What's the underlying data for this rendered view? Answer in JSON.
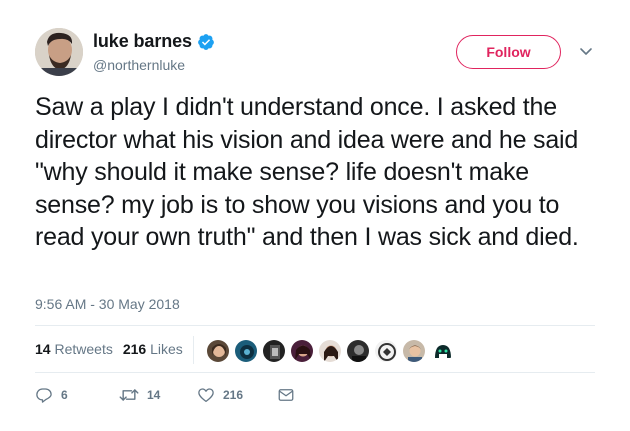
{
  "user": {
    "name": "luke barnes",
    "handle": "@northernluke",
    "verified": true
  },
  "follow_button": {
    "label": "Follow",
    "color": "#e0245e"
  },
  "tweet": {
    "text": "Saw a play I didn't understand once. I asked the director what his vision and idea were and he said \"why should it make sense? life doesn't make sense? my job is to show you visions and you to read your own truth\" and then I was sick and died.",
    "timestamp": "9:56 AM - 30 May 2018"
  },
  "stats": {
    "retweets_count": "14",
    "retweets_label": "Retweets",
    "likes_count": "216",
    "likes_label": "Likes"
  },
  "liker_avatars": [
    {
      "name": "liker-1"
    },
    {
      "name": "liker-2"
    },
    {
      "name": "liker-3"
    },
    {
      "name": "liker-4"
    },
    {
      "name": "liker-5"
    },
    {
      "name": "liker-6"
    },
    {
      "name": "liker-7"
    },
    {
      "name": "liker-8"
    },
    {
      "name": "liker-9"
    },
    {
      "name": "liker-10"
    }
  ],
  "actions": {
    "reply_count": "6",
    "retweet_count": "14",
    "like_count": "216"
  },
  "icons": {
    "verified": "verified-badge-icon",
    "caret": "chevron-down-icon",
    "reply": "reply-icon",
    "retweet": "retweet-icon",
    "like": "heart-icon",
    "dm": "envelope-icon"
  },
  "colors": {
    "text": "#14171a",
    "secondary": "#657786",
    "verified": "#1da1f2",
    "divider": "#e6ecf0"
  }
}
